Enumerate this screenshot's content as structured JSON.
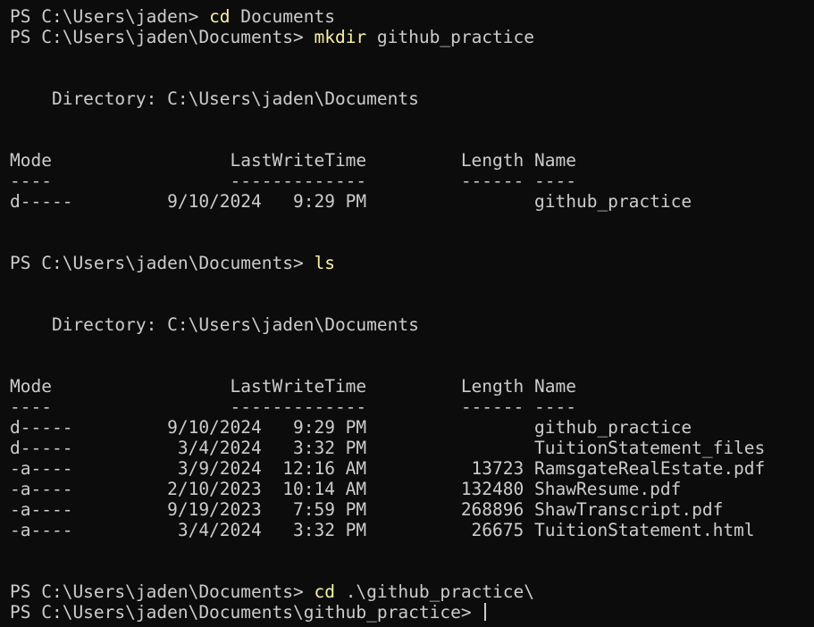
{
  "colors": {
    "background": "#0c0c0c",
    "text": "#cccccc",
    "command": "#f9f1a5"
  },
  "lines": {
    "l1": {
      "prompt": "PS C:\\Users\\jaden> ",
      "cmd": "cd",
      "rest": " Documents"
    },
    "l2": {
      "prompt": "PS C:\\Users\\jaden\\Documents> ",
      "cmd": "mkdir",
      "rest": " github_practice"
    },
    "dir1": "    Directory: C:\\Users\\jaden\\Documents",
    "hdr1": "Mode                 LastWriteTime         Length Name",
    "sep1": "----                 -------------         ------ ----",
    "row1": "d-----         9/10/2024   9:29 PM                github_practice",
    "l3": {
      "prompt": "PS C:\\Users\\jaden\\Documents> ",
      "cmd": "ls"
    },
    "dir2": "    Directory: C:\\Users\\jaden\\Documents",
    "hdr2": "Mode                 LastWriteTime         Length Name",
    "sep2": "----                 -------------         ------ ----",
    "rows2": [
      "d-----         9/10/2024   9:29 PM                github_practice",
      "d-----          3/4/2024   3:32 PM                TuitionStatement_files",
      "-a----          3/9/2024  12:16 AM          13723 RamsgateRealEstate.pdf",
      "-a----         2/10/2023  10:14 AM         132480 ShawResume.pdf",
      "-a----         9/19/2023   7:59 PM         268896 ShawTranscript.pdf",
      "-a----          3/4/2024   3:32 PM          26675 TuitionStatement.html"
    ],
    "l4": {
      "prompt": "PS C:\\Users\\jaden\\Documents> ",
      "cmd": "cd",
      "rest": " .\\github_practice\\"
    },
    "l5": {
      "prompt": "PS C:\\Users\\jaden\\Documents\\github_practice> "
    }
  }
}
